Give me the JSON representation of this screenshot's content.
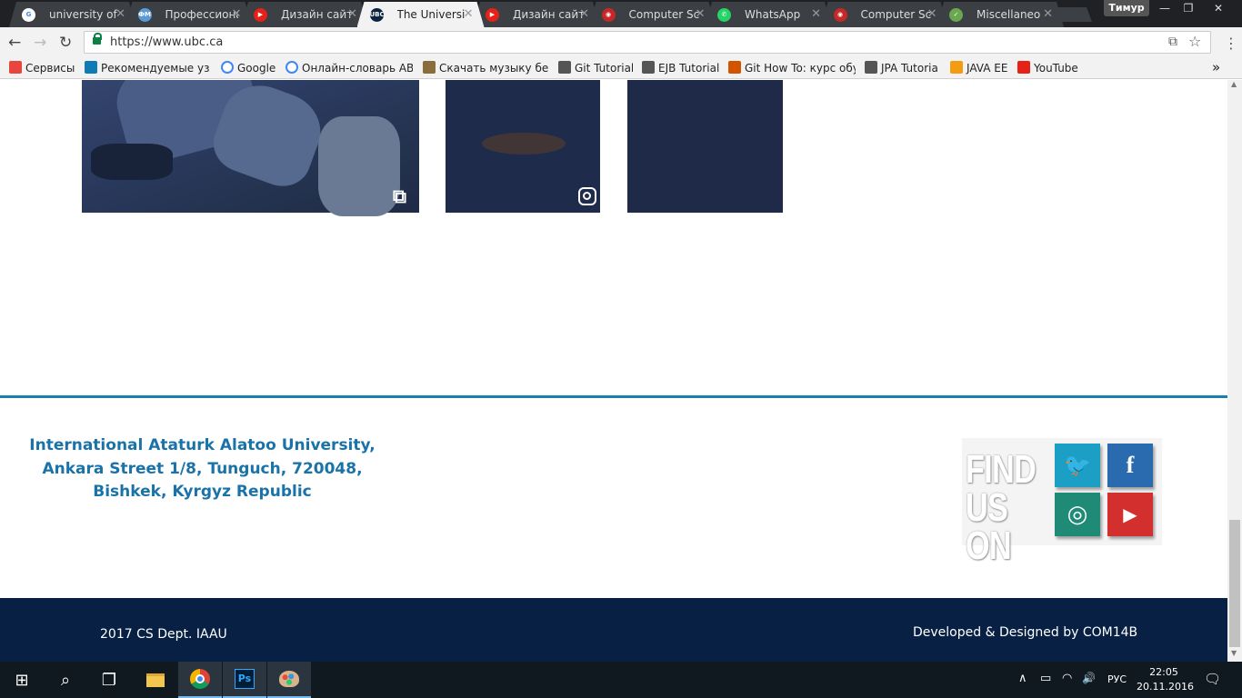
{
  "browser": {
    "tabs": [
      {
        "label": "university of",
        "favicon_color": "#ffffff",
        "favicon_text": "G"
      },
      {
        "label": "Профессиона",
        "favicon_color": "#5b9bd5",
        "favicon_text": "ФМ"
      },
      {
        "label": "Дизайн сайт",
        "favicon_color": "#e62117",
        "favicon_text": "▶"
      },
      {
        "label": "The Universi",
        "favicon_color": "#0c2340",
        "favicon_text": "UBC",
        "active": true
      },
      {
        "label": "Дизайн сайт",
        "favicon_color": "#e62117",
        "favicon_text": "▶"
      },
      {
        "label": "Computer Sc",
        "favicon_color": "#c62828",
        "favicon_text": "◉"
      },
      {
        "label": "WhatsApp",
        "favicon_color": "#25d366",
        "favicon_text": "✆"
      },
      {
        "label": "Computer Sc",
        "favicon_color": "#c62828",
        "favicon_text": "◉"
      },
      {
        "label": "Miscellaneo",
        "favicon_color": "#6aa84f",
        "favicon_text": "✓"
      }
    ],
    "tab_close": "✕",
    "user_name": "Тимур",
    "window_controls": {
      "minimize": "—",
      "restore": "❐",
      "close": "✕"
    },
    "nav": {
      "back": "←",
      "forward": "→",
      "reload": "↻"
    },
    "url": "https://www.ubc.ca",
    "translate_icon": "⧉",
    "star_icon": "☆",
    "menu_icon": "⋮",
    "bookmarks": [
      {
        "label": "Сервисы",
        "icon_color": "#e8453c"
      },
      {
        "label": "Рекомендуемые узлы",
        "icon_color": "#0f7bb5"
      },
      {
        "label": "Google",
        "icon_color": "#ffffff"
      },
      {
        "label": "Онлайн-словарь ABB",
        "icon_color": "#ffffff"
      },
      {
        "label": "Скачать музыку бесп",
        "icon_color": "#8a6d3b"
      },
      {
        "label": "Git Tutorial",
        "icon_color": "#555555"
      },
      {
        "label": "EJB Tutorial",
        "icon_color": "#555555"
      },
      {
        "label": "Git How To: курс обу",
        "icon_color": "#d35400"
      },
      {
        "label": "JPA Tutorial",
        "icon_color": "#555555"
      },
      {
        "label": "JAVA EE",
        "icon_color": "#f39c12"
      },
      {
        "label": "YouTube",
        "icon_color": "#e62117"
      }
    ],
    "bookmarks_more": "»"
  },
  "page": {
    "address_lines": [
      "International Ataturk Alatoo University,",
      "Ankara Street 1/8, Tunguch, 720048,",
      "Bishkek, Kyrgyz Republic"
    ],
    "find_us": {
      "line1": "FIND",
      "line2": "US ON",
      "networks": [
        {
          "name": "twitter",
          "glyph": "🐦",
          "color": "#1b9fc4"
        },
        {
          "name": "facebook",
          "glyph": "f",
          "color": "#2a6bb0"
        },
        {
          "name": "instagram",
          "glyph": "◎",
          "color": "#1f8a76"
        },
        {
          "name": "youtube",
          "glyph": "▶",
          "color": "#d32f2f"
        }
      ]
    },
    "copyright": "2017 CS Dept. IAAU",
    "credits": "Developed & Designed by COM14B",
    "colors": {
      "accent": "#1a7fae",
      "footer_bg": "#072044",
      "address": "#1a73a8"
    }
  },
  "taskbar": {
    "start_icon": "⊞",
    "search_icon": "⌕",
    "taskview_icon": "❐",
    "apps": [
      "file-explorer",
      "chrome",
      "photoshop",
      "paint"
    ],
    "tray": {
      "up_arrow": "∧",
      "battery": "▭",
      "wifi": "◠",
      "volume": "🔊",
      "language": "РУС",
      "notifications": "🗨"
    },
    "time": "22:05",
    "date": "20.11.2016"
  }
}
